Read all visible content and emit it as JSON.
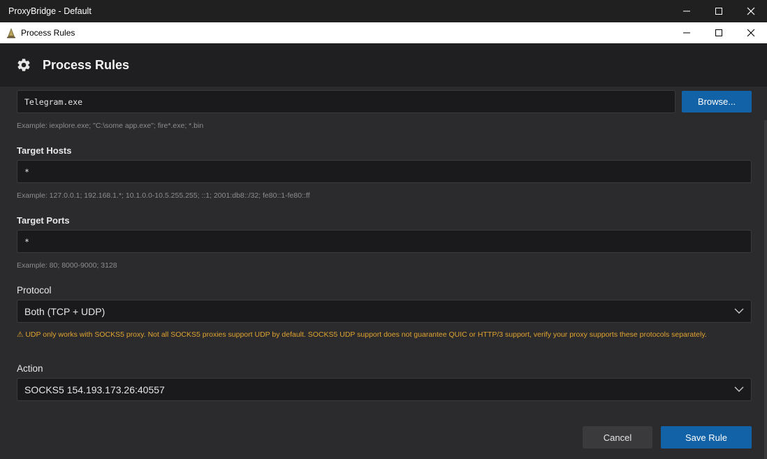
{
  "outer_window": {
    "title": "ProxyBridge - Default"
  },
  "dialog_window": {
    "title": "Process Rules"
  },
  "header": {
    "title": "Process Rules",
    "icon": "gear-icon"
  },
  "form": {
    "process": {
      "value": "Telegram.exe",
      "browse_label": "Browse...",
      "hint": "Example: iexplore.exe; \"C:\\some app.exe\"; fire*.exe; *.bin"
    },
    "target_hosts": {
      "label": "Target Hosts",
      "value": "*",
      "hint": "Example: 127.0.0.1; 192.168.1.*; 10.1.0.0-10.5.255.255; ::1; 2001:db8::/32; fe80::1-fe80::ff"
    },
    "target_ports": {
      "label": "Target Ports",
      "value": "*",
      "hint": "Example: 80; 8000-9000; 3128"
    },
    "protocol": {
      "label": "Protocol",
      "selected": "Both (TCP + UDP)",
      "warning": "⚠ UDP only works with SOCKS5 proxy. Not all SOCKS5 proxies support UDP by default. SOCKS5 UDP support does not guarantee QUIC or HTTP/3 support, verify your proxy supports these protocols separately."
    },
    "action": {
      "label": "Action",
      "selected": "SOCKS5 154.193.173.26:40557"
    }
  },
  "footer": {
    "cancel_label": "Cancel",
    "save_label": "Save Rule"
  },
  "colors": {
    "accent": "#1262a8",
    "warning": "#e0a32e",
    "background": "#2b2b2e"
  }
}
